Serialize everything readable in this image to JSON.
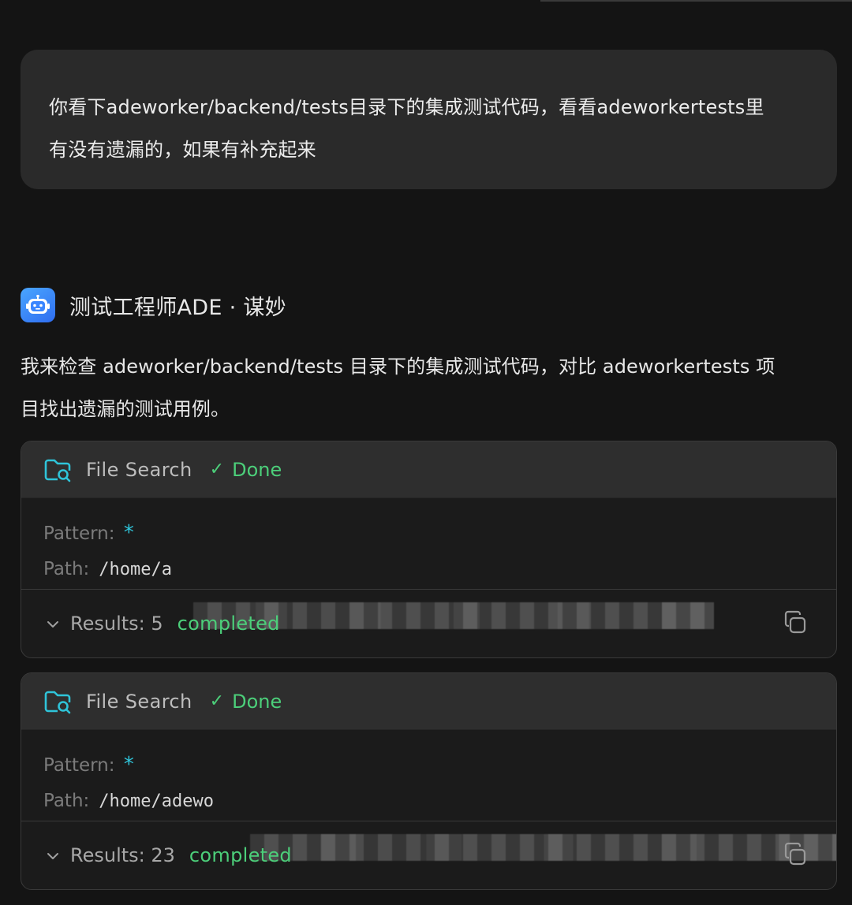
{
  "user_message": {
    "line1": "你看下adeworker/backend/tests目录下的集成测试代码，看看adeworkertests里",
    "line2": "有没有遗漏的，如果有补充起来"
  },
  "agent": {
    "avatar_icon": "robot-icon",
    "name": "测试工程师ADE · 谋妙",
    "message_line1": "我来检查 adeworker/backend/tests 目录下的集成测试代码，对比 adeworkertests 项",
    "message_line2": "目找出遗漏的测试用例。"
  },
  "tool_calls": [
    {
      "icon": "folder-search-icon",
      "name": "File Search",
      "status": "Done",
      "pattern_label": "Pattern:",
      "pattern_value": "*",
      "path_label": "Path:",
      "path_value": "/home/a",
      "results_label": "Results: 5",
      "results_status": "completed"
    },
    {
      "icon": "folder-search-icon",
      "name": "File Search",
      "status": "Done",
      "pattern_label": "Pattern:",
      "pattern_value": "*",
      "path_label": "Path:",
      "path_value": "/home/adewo",
      "results_label": "Results: 23",
      "results_status": "completed"
    }
  ],
  "colors": {
    "background": "#141414",
    "bubble": "#2a2a2a",
    "success": "#4ccf7a",
    "pattern_accent": "#2fc4d9",
    "avatar": "#3a8bff"
  }
}
